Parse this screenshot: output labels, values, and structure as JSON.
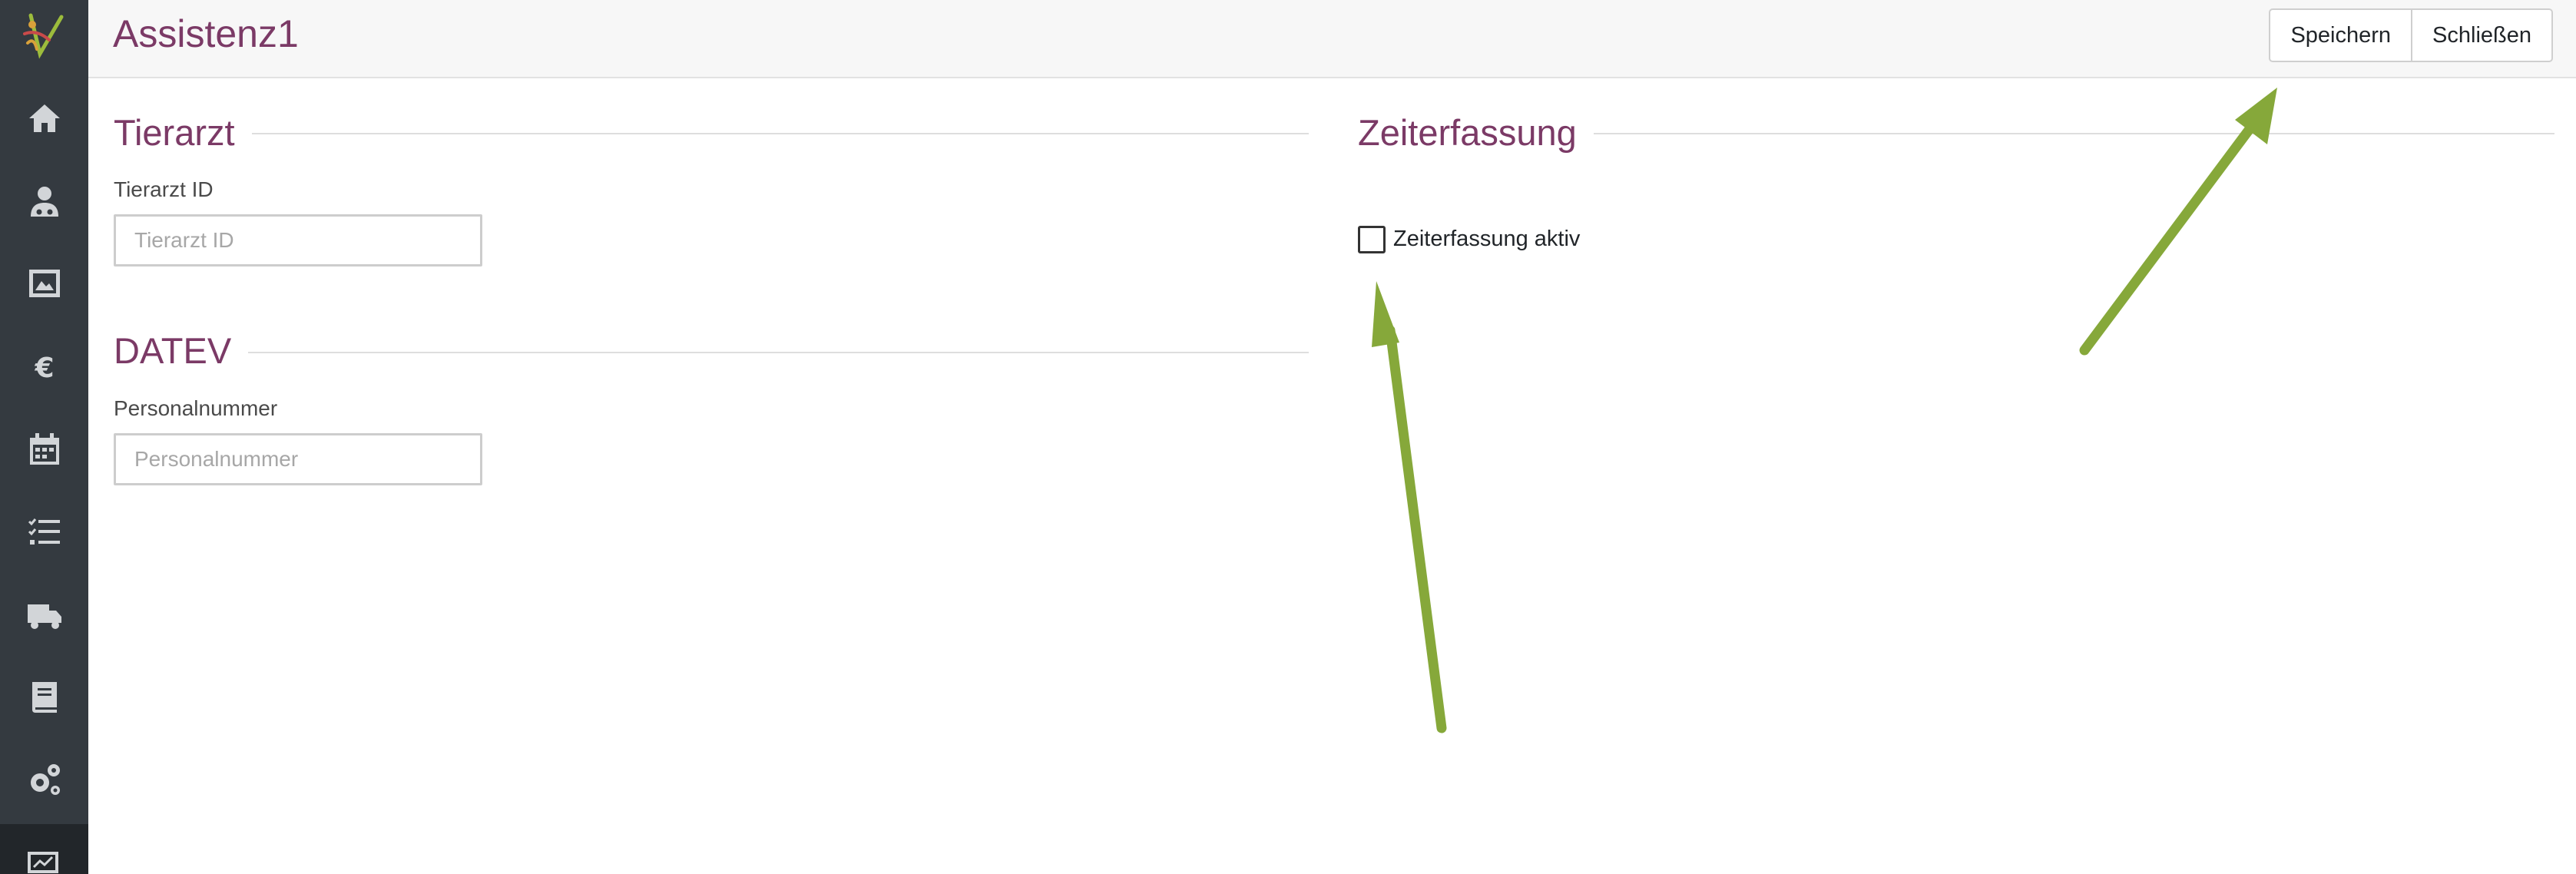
{
  "app": {
    "page_title": "Assistenz1"
  },
  "toolbar": {
    "save_label": "Speichern",
    "close_label": "Schließen"
  },
  "sidebar": {
    "items": [
      {
        "icon": "home-icon"
      },
      {
        "icon": "user-doctor-icon"
      },
      {
        "icon": "image-icon"
      },
      {
        "icon": "euro-icon"
      },
      {
        "icon": "calendar-icon"
      },
      {
        "icon": "task-list-icon"
      },
      {
        "icon": "truck-icon"
      },
      {
        "icon": "book-icon"
      },
      {
        "icon": "settings-icon"
      },
      {
        "icon": "chart-icon",
        "active": true
      }
    ]
  },
  "sections": {
    "tierarzt": {
      "title": "Tierarzt",
      "field_label": "Tierarzt ID",
      "field_placeholder": "Tierarzt ID",
      "field_value": ""
    },
    "datev": {
      "title": "DATEV",
      "field_label": "Personalnummer",
      "field_placeholder": "Personalnummer",
      "field_value": ""
    },
    "zeiterfassung": {
      "title": "Zeiterfassung",
      "checkbox_label": "Zeiterfassung aktiv",
      "checkbox_checked": false
    }
  },
  "colors": {
    "accent": "#7b3a66",
    "sidebar_bg": "#343a40",
    "annotation_arrow": "#86a83a"
  }
}
